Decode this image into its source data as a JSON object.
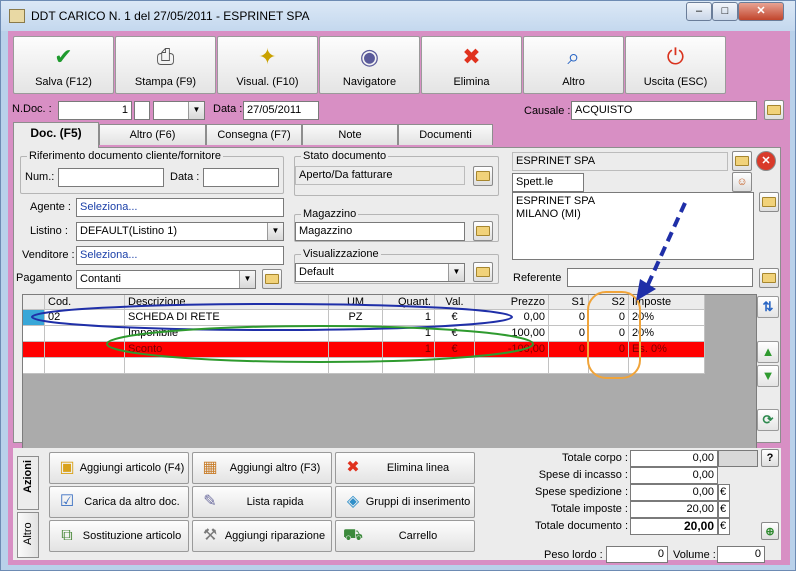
{
  "window": {
    "title": "DDT CARICO N. 1  del 27/05/2011 - ESPRINET SPA",
    "min": "–",
    "max": "□",
    "close": "✕"
  },
  "toolbar": [
    {
      "label": "Salva (F12)",
      "icon": "✔",
      "color": "#1f9a2e"
    },
    {
      "label": "Stampa (F9)",
      "icon": "⎙",
      "color": "#555555"
    },
    {
      "label": "Visual. (F10)",
      "icon": "✦",
      "color": "#c9a100"
    },
    {
      "label": "Navigatore",
      "icon": "◉",
      "color": "#5a5a9a"
    },
    {
      "label": "Elimina",
      "icon": "✖",
      "color": "#e0321e"
    },
    {
      "label": "Altro",
      "icon": "⌕",
      "color": "#2a66c4"
    },
    {
      "label": "Uscita (ESC)",
      "icon": "⏻",
      "color": "#d9331e"
    }
  ],
  "header": {
    "ndoc_label": "N.Doc. :",
    "ndoc_value": "1",
    "data_label": "Data :",
    "data_value": "27/05/2011",
    "causale_label": "Causale :",
    "causale_value": "ACQUISTO"
  },
  "tabs": [
    "Doc. (F5)",
    "Altro (F6)",
    "Consegna (F7)",
    "Note",
    "Documenti"
  ],
  "riferimento": {
    "title": "Riferimento documento cliente/fornitore",
    "num_label": "Num.:",
    "num_value": "",
    "data_label": "Data :",
    "data_value": ""
  },
  "stato": {
    "title": "Stato documento",
    "value": "Aperto/Da fatturare"
  },
  "magazzino": {
    "title": "Magazzino",
    "value": "Magazzino"
  },
  "visualizzazione": {
    "title": "Visualizzazione",
    "value": "Default"
  },
  "fields": {
    "agente_label": "Agente :",
    "agente_value": "Seleziona...",
    "listino_label": "Listino :",
    "listino_value": "DEFAULT(Listino 1)",
    "venditore_label": "Venditore :",
    "venditore_value": "Seleziona...",
    "pagamento_label": "Pagamento :",
    "pagamento_value": "Contanti"
  },
  "fornitore": {
    "name": "ESPRINET SPA",
    "title": "Spett.le",
    "address_line1": "ESPRINET SPA",
    "address_line2": "MILANO (MI)",
    "referente_label": "Referente",
    "referente_value": ""
  },
  "grid": {
    "columns": [
      "Cod.",
      "Descrizione",
      "UM",
      "Quant.",
      "Val.",
      "Prezzo",
      "S1",
      "S2",
      "Imposte"
    ],
    "rows": [
      {
        "cod": "02",
        "descrizione": "SCHEDA DI RETE",
        "um": "PZ",
        "quant": "1",
        "val": "€",
        "prezzo": "0,00",
        "s1": "0",
        "s2": "0",
        "imposte": "20%"
      },
      {
        "cod": "",
        "descrizione": "Imponibile",
        "um": "",
        "quant": "1",
        "val": "€",
        "prezzo": "100,00",
        "s1": "0",
        "s2": "0",
        "imposte": "20%"
      },
      {
        "cod": "",
        "descrizione": "Sconto",
        "um": "",
        "quant": "1",
        "val": "€",
        "prezzo": "-100,00",
        "s1": "0",
        "s2": "0",
        "imposte": "Es. 0%"
      }
    ]
  },
  "side_tabs": [
    "Azioni",
    "Altro"
  ],
  "actions": [
    {
      "label": "Aggiungi articolo (F4)",
      "icon": "▣",
      "color": "#d9a21b"
    },
    {
      "label": "Aggiungi altro (F3)",
      "icon": "▦",
      "color": "#c87d2a"
    },
    {
      "label": "Elimina linea",
      "icon": "✖",
      "color": "#e0321e"
    },
    {
      "label": "Carica da altro doc.",
      "icon": "☑",
      "color": "#3a6fc2"
    },
    {
      "label": "Lista rapida",
      "icon": "✎",
      "color": "#6b6b9e"
    },
    {
      "label": "Gruppi di inserimento",
      "icon": "◈",
      "color": "#2f8fc9"
    },
    {
      "label": "Sostituzione articolo",
      "icon": "⧉",
      "color": "#4c8a3c"
    },
    {
      "label": "Aggiungi riparazione",
      "icon": "⚒",
      "color": "#7a7a7a"
    },
    {
      "label": "Carrello",
      "icon": "⛟",
      "color": "#3c8a3c"
    }
  ],
  "totals": [
    {
      "label": "Totale corpo :",
      "value": "0,00",
      "suffix": ""
    },
    {
      "label": "Spese di incasso :",
      "value": "0,00",
      "suffix": ""
    },
    {
      "label": "Spese spedizione :",
      "value": "0,00",
      "suffix": "€"
    },
    {
      "label": "Totale imposte :",
      "value": "20,00",
      "suffix": "€"
    },
    {
      "label": "Totale documento :",
      "value": "20,00",
      "suffix": "€"
    }
  ],
  "help_button": "?",
  "peso": {
    "label": "Peso lordo :",
    "value": "0",
    "volume_label": "Volume :",
    "volume_value": "0"
  }
}
